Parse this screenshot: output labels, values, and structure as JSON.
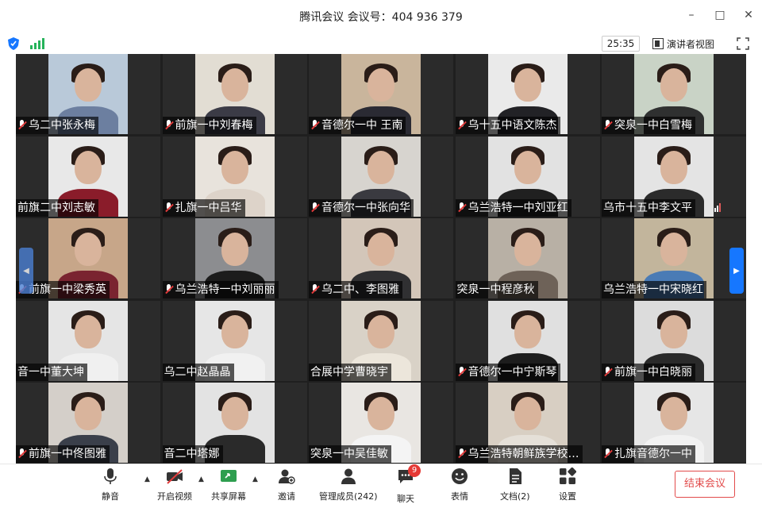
{
  "window": {
    "title": "腾讯会议 会议号：404 936 379"
  },
  "statusbar": {
    "timer": "25:35",
    "speaker_view": "演讲者视图"
  },
  "participants": [
    {
      "name": "乌二中张永梅",
      "muted": true,
      "bg": "#b9c9d9",
      "body": "#6c7fa0"
    },
    {
      "name": "前旗一中刘春梅",
      "muted": true,
      "bg": "#e2ddd3",
      "body": "#3b3b46"
    },
    {
      "name": "音德尔一中  王南",
      "muted": true,
      "bg": "#c9b59c",
      "body": "#2a2a33"
    },
    {
      "name": "乌十五中语文陈杰",
      "muted": true,
      "bg": "#eaeaea",
      "body": "#222226"
    },
    {
      "name": "突泉一中白雪梅",
      "muted": true,
      "bg": "#c9d3c6",
      "body": "#2f3030"
    },
    {
      "name": "前旗二中刘志敏",
      "muted": false,
      "bg": "#e8e8e8",
      "body": "#8a1c2a"
    },
    {
      "name": "扎旗一中吕华",
      "muted": true,
      "bg": "#e8e3dc",
      "body": "#ddd3c9"
    },
    {
      "name": "音德尔一中张向华",
      "muted": true,
      "bg": "#d7d4cf",
      "body": "#3a3a40"
    },
    {
      "name": "乌兰浩特一中刘亚红",
      "muted": true,
      "bg": "#e2e2e2",
      "body": "#202020"
    },
    {
      "name": "乌市十五中李文平",
      "muted": false,
      "bg": "#e4e4e4",
      "body": "#2b2b2b"
    },
    {
      "name": "前旗一中梁秀英",
      "muted": true,
      "bg": "#c7a689",
      "body": "#7a2430"
    },
    {
      "name": "乌兰浩特一中刘丽丽",
      "muted": true,
      "bg": "#8c8d90",
      "body": "#1c1c1c"
    },
    {
      "name": "乌二中、李图雅",
      "muted": true,
      "bg": "#d3c6b9",
      "body": "#303032"
    },
    {
      "name": "突泉一中程彦秋",
      "muted": false,
      "bg": "#b8b0a5",
      "body": "#6e6258"
    },
    {
      "name": "乌兰浩特一中宋晓红",
      "muted": false,
      "bg": "#c2b59c",
      "body": "#4a7bb5"
    },
    {
      "name": "音一中董大坤",
      "muted": false,
      "bg": "#e5e5e5",
      "body": "#f0f0f0"
    },
    {
      "name": "乌二中赵晶晶",
      "muted": false,
      "bg": "#e6e6e6",
      "body": "#f1f1f1"
    },
    {
      "name": "合展中学曹晓宇",
      "muted": false,
      "bg": "#d9d2c7",
      "body": "#ece6db"
    },
    {
      "name": "音德尔一中宁斯琴",
      "muted": true,
      "bg": "#e0e0e0",
      "body": "#1d1d1d"
    },
    {
      "name": "前旗一中白晓丽",
      "muted": true,
      "bg": "#dcdcdc",
      "body": "#2a2a2a"
    },
    {
      "name": "前旗一中佟图雅",
      "muted": true,
      "bg": "#d4cfc9",
      "body": "#3a3f4a"
    },
    {
      "name": "音二中塔娜",
      "muted": false,
      "bg": "#e3e3e3",
      "body": "#2a2a2a"
    },
    {
      "name": "突泉一中吴佳敏",
      "muted": false,
      "bg": "#e9e6e2",
      "body": "#f4f4f4"
    },
    {
      "name": "乌兰浩特朝鲜族学校…",
      "muted": true,
      "bg": "#d8cfc3",
      "body": "#e5e0d8"
    },
    {
      "name": "扎旗音德尔一中",
      "muted": true,
      "bg": "#e6e6e6",
      "body": "#f2f2f2"
    }
  ],
  "toolbar": {
    "mute": "静音",
    "video": "开启视频",
    "share": "共享屏幕",
    "invite": "邀请",
    "members": "管理成员(242)",
    "chat": "聊天",
    "chat_badge": "9",
    "reactions": "表情",
    "docs": "文档(2)",
    "settings": "设置",
    "end": "结束会议"
  },
  "colors": {
    "accent": "#1677ff",
    "end": "#e24b4b",
    "signal": "#26b35a"
  }
}
